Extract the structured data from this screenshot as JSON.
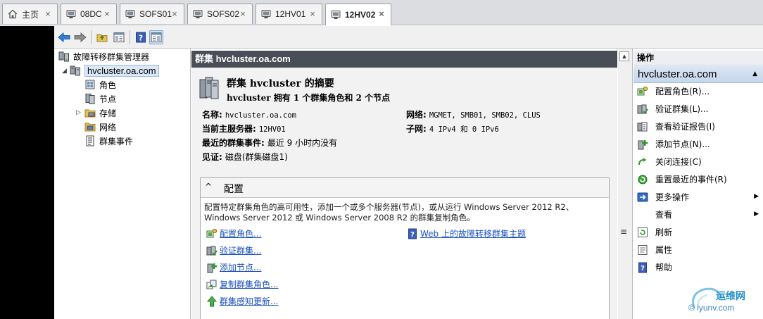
{
  "tabs": [
    {
      "label": "主页",
      "icon": "home-icon",
      "active": false
    },
    {
      "label": "08DC",
      "icon": "vm-icon",
      "active": false
    },
    {
      "label": "SOFS01",
      "icon": "vm-icon",
      "active": false
    },
    {
      "label": "SOFS02",
      "icon": "vm-icon",
      "active": false
    },
    {
      "label": "12HV01",
      "icon": "vm-icon",
      "active": false
    },
    {
      "label": "12HV02",
      "icon": "vm-icon",
      "active": true
    }
  ],
  "tab_close": "×",
  "toolbar": {
    "icons": [
      "back-arrow-icon",
      "forward-arrow-icon",
      "up-folder-icon",
      "show-hide-console-tree-icon",
      "help-icon",
      "show-hide-action-pane-icon"
    ]
  },
  "tree": {
    "root": "故障转移群集管理器",
    "cluster": "hvcluster.oa.com",
    "children": [
      "角色",
      "节点",
      "存储",
      "网络",
      "群集事件"
    ]
  },
  "center": {
    "header": "群集 hvcluster.oa.com",
    "summary_title": "群集 hvcluster 的摘要",
    "summary_sub": "hvcluster 拥有 1 个群集角色和 2 个节点",
    "fields": {
      "name_label": "名称:",
      "name_value": "hvcluster.oa.com",
      "host_label": "当前主服务器:",
      "host_value": "12HV01",
      "events_label": "最近的群集事件:",
      "events_value": "最近 9 小时内没有",
      "witness_label": "见证:",
      "witness_value": "磁盘(群集磁盘1)",
      "network_label": "网络:",
      "network_value": "MGMET, SMB01, SMB02, CLUS",
      "subnet_label": "子网:",
      "subnet_value": "4 IPv4 和 0 IPv6"
    },
    "config": {
      "caret": "^",
      "title": "配置",
      "description": "配置特定群集角色的高可用性，添加一个或多个服务器(节点)，或从运行 Windows Server 2012 R2、Windows Server 2012 或 Windows Server 2008 R2 的群集复制角色。",
      "links": [
        "配置角色...",
        "验证群集...",
        "添加节点...",
        "复制群集角色...",
        "群集感知更新..."
      ],
      "web_link": "Web 上的故障转移群集主题"
    }
  },
  "splitter": {
    "grip": "≡",
    "box": "▲"
  },
  "actions": {
    "header": "操作",
    "section": "hvcluster.oa.com",
    "section_caret": "▲",
    "submenu_arrow": "▶",
    "items": [
      "配置角色(R)...",
      "验证群集(L)...",
      "查看验证报告(I)",
      "添加节点(N)...",
      "关闭连接(C)",
      "重置最近的事件(R)",
      "更多操作",
      "查看",
      "刷新",
      "属性",
      "帮助"
    ]
  },
  "watermark": {
    "line1": "运维网",
    "line2": "© iyunv.com"
  }
}
